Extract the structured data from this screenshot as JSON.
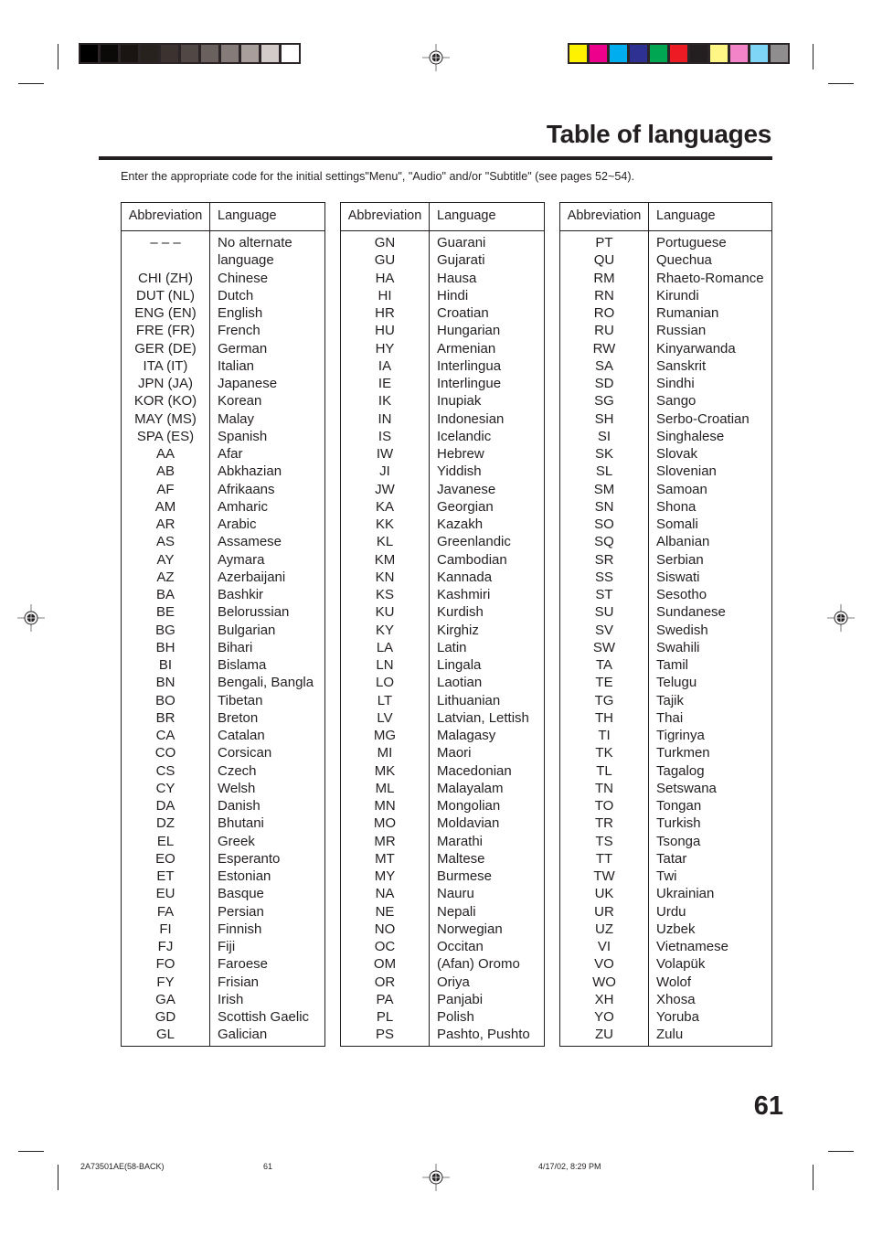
{
  "page": {
    "title": "Table of languages",
    "intro": "Enter the appropriate code for the initial settings\"Menu\", \"Audio\" and/or \"Subtitle\" (see pages 52~54).",
    "page_number": "61",
    "footer": {
      "file_label": "2A73501AE(58-BACK)",
      "page": "61",
      "timestamp": "4/17/02, 8:29 PM"
    }
  },
  "color_bars": {
    "grayscale": [
      "#000000",
      "#0c0a09",
      "#1a1513",
      "#28221f",
      "#3c3331",
      "#514745",
      "#6a605e",
      "#857b79",
      "#a89f9d",
      "#d2cbca",
      "#ffffff"
    ],
    "process": [
      "#fff200",
      "#ec008c",
      "#00aeef",
      "#2e3192",
      "#00a651",
      "#ed1c24",
      "#231f20",
      "#fff685",
      "#f384c7",
      "#7fd5f6",
      "#8f8d8e"
    ]
  },
  "table_headers": {
    "abbreviation": "Abbreviation",
    "language": "Language"
  },
  "tables": [
    {
      "rows": [
        {
          "code": "– – –",
          "lang": "No alternate"
        },
        {
          "code": "",
          "lang": "language"
        },
        {
          "code": "CHI (ZH)",
          "lang": "Chinese"
        },
        {
          "code": "DUT (NL)",
          "lang": "Dutch"
        },
        {
          "code": "ENG (EN)",
          "lang": "English"
        },
        {
          "code": "FRE (FR)",
          "lang": "French"
        },
        {
          "code": "GER (DE)",
          "lang": "German"
        },
        {
          "code": "ITA (IT)",
          "lang": "Italian"
        },
        {
          "code": "JPN (JA)",
          "lang": "Japanese"
        },
        {
          "code": "KOR (KO)",
          "lang": "Korean"
        },
        {
          "code": "MAY (MS)",
          "lang": "Malay"
        },
        {
          "code": "SPA (ES)",
          "lang": "Spanish"
        },
        {
          "code": "AA",
          "lang": "Afar"
        },
        {
          "code": "AB",
          "lang": "Abkhazian"
        },
        {
          "code": "AF",
          "lang": "Afrikaans"
        },
        {
          "code": "AM",
          "lang": "Amharic"
        },
        {
          "code": "AR",
          "lang": "Arabic"
        },
        {
          "code": "AS",
          "lang": "Assamese"
        },
        {
          "code": "AY",
          "lang": "Aymara"
        },
        {
          "code": "AZ",
          "lang": "Azerbaijani"
        },
        {
          "code": "BA",
          "lang": "Bashkir"
        },
        {
          "code": "BE",
          "lang": "Belorussian"
        },
        {
          "code": "BG",
          "lang": "Bulgarian"
        },
        {
          "code": "BH",
          "lang": "Bihari"
        },
        {
          "code": "BI",
          "lang": "Bislama"
        },
        {
          "code": "BN",
          "lang": "Bengali, Bangla"
        },
        {
          "code": "BO",
          "lang": "Tibetan"
        },
        {
          "code": "BR",
          "lang": "Breton"
        },
        {
          "code": "CA",
          "lang": "Catalan"
        },
        {
          "code": "CO",
          "lang": "Corsican"
        },
        {
          "code": "CS",
          "lang": "Czech"
        },
        {
          "code": "CY",
          "lang": "Welsh"
        },
        {
          "code": "DA",
          "lang": "Danish"
        },
        {
          "code": "DZ",
          "lang": "Bhutani"
        },
        {
          "code": "EL",
          "lang": "Greek"
        },
        {
          "code": "EO",
          "lang": "Esperanto"
        },
        {
          "code": "ET",
          "lang": "Estonian"
        },
        {
          "code": "EU",
          "lang": "Basque"
        },
        {
          "code": "FA",
          "lang": "Persian"
        },
        {
          "code": "FI",
          "lang": "Finnish"
        },
        {
          "code": "FJ",
          "lang": "Fiji"
        },
        {
          "code": "FO",
          "lang": "Faroese"
        },
        {
          "code": "FY",
          "lang": "Frisian"
        },
        {
          "code": "GA",
          "lang": "Irish"
        },
        {
          "code": "GD",
          "lang": "Scottish Gaelic"
        },
        {
          "code": "GL",
          "lang": "Galician"
        }
      ]
    },
    {
      "rows": [
        {
          "code": "GN",
          "lang": "Guarani"
        },
        {
          "code": "GU",
          "lang": "Gujarati"
        },
        {
          "code": "HA",
          "lang": "Hausa"
        },
        {
          "code": "HI",
          "lang": "Hindi"
        },
        {
          "code": "HR",
          "lang": "Croatian"
        },
        {
          "code": "HU",
          "lang": "Hungarian"
        },
        {
          "code": "HY",
          "lang": "Armenian"
        },
        {
          "code": "IA",
          "lang": "Interlingua"
        },
        {
          "code": "IE",
          "lang": "Interlingue"
        },
        {
          "code": "IK",
          "lang": "Inupiak"
        },
        {
          "code": "IN",
          "lang": "Indonesian"
        },
        {
          "code": "IS",
          "lang": "Icelandic"
        },
        {
          "code": "IW",
          "lang": "Hebrew"
        },
        {
          "code": "JI",
          "lang": "Yiddish"
        },
        {
          "code": "JW",
          "lang": "Javanese"
        },
        {
          "code": "KA",
          "lang": "Georgian"
        },
        {
          "code": "KK",
          "lang": "Kazakh"
        },
        {
          "code": "KL",
          "lang": "Greenlandic"
        },
        {
          "code": "KM",
          "lang": "Cambodian"
        },
        {
          "code": "KN",
          "lang": "Kannada"
        },
        {
          "code": "KS",
          "lang": "Kashmiri"
        },
        {
          "code": "KU",
          "lang": "Kurdish"
        },
        {
          "code": "KY",
          "lang": "Kirghiz"
        },
        {
          "code": "LA",
          "lang": "Latin"
        },
        {
          "code": "LN",
          "lang": "Lingala"
        },
        {
          "code": "LO",
          "lang": "Laotian"
        },
        {
          "code": "LT",
          "lang": "Lithuanian"
        },
        {
          "code": "LV",
          "lang": "Latvian, Lettish"
        },
        {
          "code": "MG",
          "lang": "Malagasy"
        },
        {
          "code": "MI",
          "lang": "Maori"
        },
        {
          "code": "MK",
          "lang": "Macedonian"
        },
        {
          "code": "ML",
          "lang": "Malayalam"
        },
        {
          "code": "MN",
          "lang": "Mongolian"
        },
        {
          "code": "MO",
          "lang": "Moldavian"
        },
        {
          "code": "MR",
          "lang": "Marathi"
        },
        {
          "code": "MT",
          "lang": "Maltese"
        },
        {
          "code": "MY",
          "lang": "Burmese"
        },
        {
          "code": "NA",
          "lang": "Nauru"
        },
        {
          "code": "NE",
          "lang": "Nepali"
        },
        {
          "code": "NO",
          "lang": "Norwegian"
        },
        {
          "code": "OC",
          "lang": "Occitan"
        },
        {
          "code": "OM",
          "lang": "(Afan) Oromo"
        },
        {
          "code": "OR",
          "lang": "Oriya"
        },
        {
          "code": "PA",
          "lang": "Panjabi"
        },
        {
          "code": "PL",
          "lang": "Polish"
        },
        {
          "code": "PS",
          "lang": "Pashto, Pushto"
        }
      ]
    },
    {
      "rows": [
        {
          "code": "PT",
          "lang": "Portuguese"
        },
        {
          "code": "QU",
          "lang": "Quechua"
        },
        {
          "code": "RM",
          "lang": "Rhaeto-Romance"
        },
        {
          "code": "RN",
          "lang": "Kirundi"
        },
        {
          "code": "RO",
          "lang": "Rumanian"
        },
        {
          "code": "RU",
          "lang": "Russian"
        },
        {
          "code": "RW",
          "lang": "Kinyarwanda"
        },
        {
          "code": "SA",
          "lang": "Sanskrit"
        },
        {
          "code": "SD",
          "lang": "Sindhi"
        },
        {
          "code": "SG",
          "lang": "Sango"
        },
        {
          "code": "SH",
          "lang": "Serbo-Croatian"
        },
        {
          "code": "SI",
          "lang": "Singhalese"
        },
        {
          "code": "SK",
          "lang": "Slovak"
        },
        {
          "code": "SL",
          "lang": "Slovenian"
        },
        {
          "code": "SM",
          "lang": "Samoan"
        },
        {
          "code": "SN",
          "lang": "Shona"
        },
        {
          "code": "SO",
          "lang": "Somali"
        },
        {
          "code": "SQ",
          "lang": "Albanian"
        },
        {
          "code": "SR",
          "lang": "Serbian"
        },
        {
          "code": "SS",
          "lang": "Siswati"
        },
        {
          "code": "ST",
          "lang": "Sesotho"
        },
        {
          "code": "SU",
          "lang": "Sundanese"
        },
        {
          "code": "SV",
          "lang": "Swedish"
        },
        {
          "code": "SW",
          "lang": "Swahili"
        },
        {
          "code": "TA",
          "lang": "Tamil"
        },
        {
          "code": "TE",
          "lang": "Telugu"
        },
        {
          "code": "TG",
          "lang": "Tajik"
        },
        {
          "code": "TH",
          "lang": "Thai"
        },
        {
          "code": "TI",
          "lang": "Tigrinya"
        },
        {
          "code": "TK",
          "lang": "Turkmen"
        },
        {
          "code": "TL",
          "lang": "Tagalog"
        },
        {
          "code": "TN",
          "lang": "Setswana"
        },
        {
          "code": "TO",
          "lang": "Tongan"
        },
        {
          "code": "TR",
          "lang": "Turkish"
        },
        {
          "code": "TS",
          "lang": "Tsonga"
        },
        {
          "code": "TT",
          "lang": "Tatar"
        },
        {
          "code": "TW",
          "lang": "Twi"
        },
        {
          "code": "UK",
          "lang": "Ukrainian"
        },
        {
          "code": "UR",
          "lang": "Urdu"
        },
        {
          "code": "UZ",
          "lang": "Uzbek"
        },
        {
          "code": "VI",
          "lang": "Vietnamese"
        },
        {
          "code": "VO",
          "lang": "Volapük"
        },
        {
          "code": "WO",
          "lang": "Wolof"
        },
        {
          "code": "XH",
          "lang": "Xhosa"
        },
        {
          "code": "YO",
          "lang": "Yoruba"
        },
        {
          "code": "ZU",
          "lang": "Zulu"
        }
      ]
    }
  ]
}
